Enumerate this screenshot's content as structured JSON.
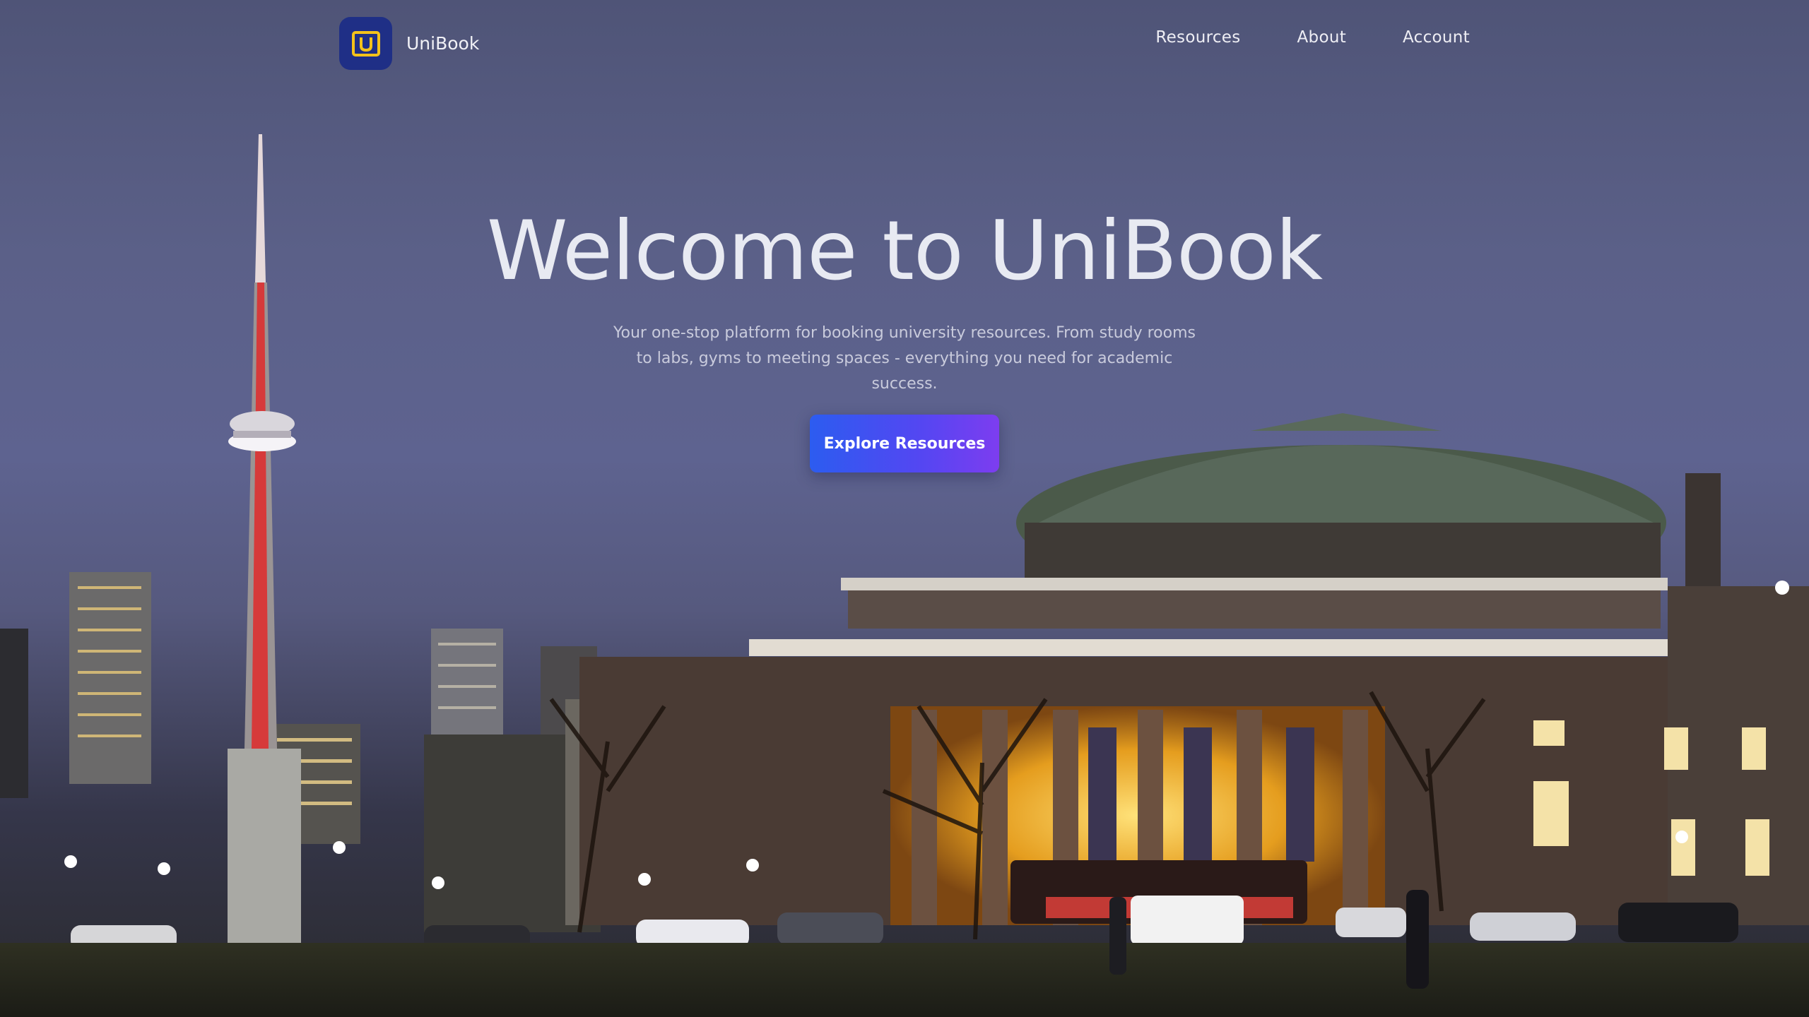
{
  "brand": {
    "name": "UniBook"
  },
  "nav": {
    "links": [
      "Resources",
      "About",
      "Account"
    ]
  },
  "hero": {
    "title": "Welcome to UniBook",
    "subtitle": "Your one-stop platform for booking university resources. From study rooms to labs, gyms to meeting spaces - everything you need for academic success.",
    "cta_label": "Explore Resources",
    "background": "campus-night-photo"
  },
  "colors": {
    "accent_start": "#2c5cf0",
    "accent_end": "#7d3df0",
    "logo_bg": "#1f2f86",
    "logo_mark": "#f4c21a"
  }
}
